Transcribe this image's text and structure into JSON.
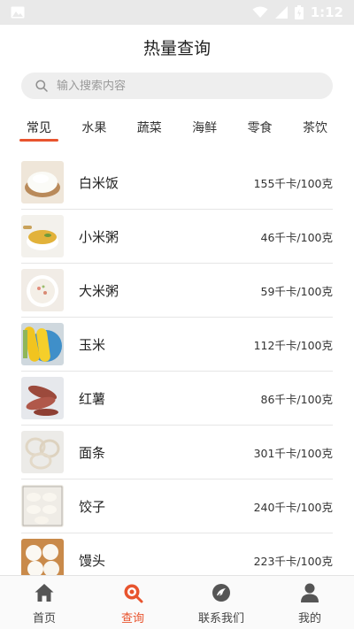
{
  "status_bar": {
    "time": "1:12"
  },
  "page": {
    "title": "热量查询"
  },
  "search": {
    "placeholder": "输入搜索内容"
  },
  "tabs": [
    {
      "label": "常见",
      "active": true
    },
    {
      "label": "水果"
    },
    {
      "label": "蔬菜"
    },
    {
      "label": "海鲜"
    },
    {
      "label": "零食"
    },
    {
      "label": "茶饮"
    }
  ],
  "foods": [
    {
      "name": "白米饭",
      "calories": "155千卡/100克"
    },
    {
      "name": "小米粥",
      "calories": "46千卡/100克"
    },
    {
      "name": "大米粥",
      "calories": "59千卡/100克"
    },
    {
      "name": "玉米",
      "calories": "112千卡/100克"
    },
    {
      "name": "红薯",
      "calories": "86千卡/100克"
    },
    {
      "name": "面条",
      "calories": "301千卡/100克"
    },
    {
      "name": "饺子",
      "calories": "240千卡/100克"
    },
    {
      "name": "馒头",
      "calories": "223千卡/100克"
    }
  ],
  "bottom_nav": [
    {
      "label": "首页",
      "icon": "home-icon"
    },
    {
      "label": "查询",
      "icon": "search-icon",
      "active": true
    },
    {
      "label": "联系我们",
      "icon": "contact-icon"
    },
    {
      "label": "我的",
      "icon": "user-icon"
    }
  ],
  "colors": {
    "accent": "#e8542e",
    "status_bar": "#e9e9e9",
    "divider": "#e6e6e6"
  }
}
